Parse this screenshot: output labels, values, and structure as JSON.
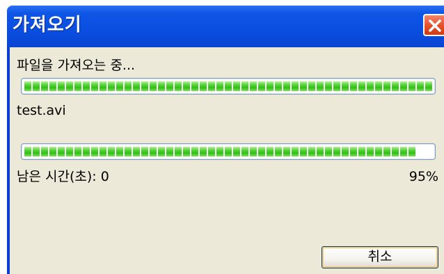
{
  "window": {
    "title": "가져오기",
    "status_text": "파일을 가져오는 중...",
    "file_name": "test.avi",
    "file_progress": 1.0,
    "total_progress": 0.95,
    "remaining_label": "남은 시간(초): 0",
    "percent_label": "95%",
    "cancel_label": "취소",
    "close_icon": "close-icon"
  },
  "colors": {
    "titlebar": "#0a4ee0",
    "client_bg": "#ece9d8",
    "progress_fill": "#2fc112",
    "close_button": "#e5532d"
  }
}
